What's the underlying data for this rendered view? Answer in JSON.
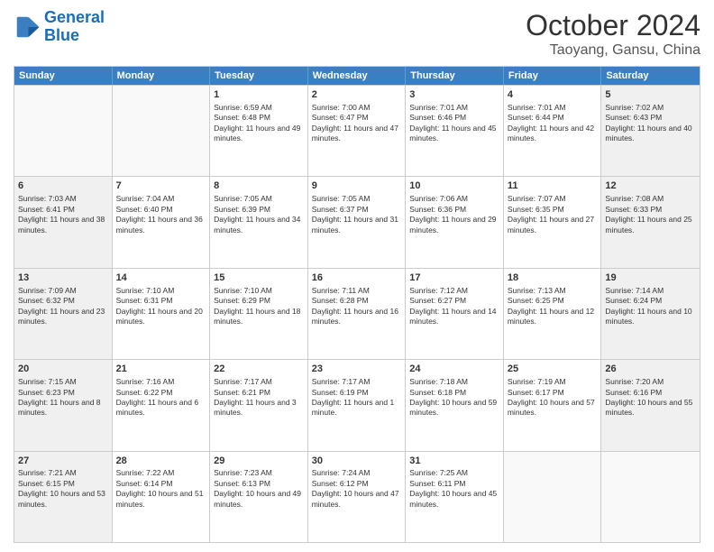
{
  "logo": {
    "line1": "General",
    "line2": "Blue"
  },
  "header": {
    "title": "October 2024",
    "subtitle": "Taoyang, Gansu, China"
  },
  "weekdays": [
    "Sunday",
    "Monday",
    "Tuesday",
    "Wednesday",
    "Thursday",
    "Friday",
    "Saturday"
  ],
  "weeks": [
    [
      {
        "day": "",
        "empty": true
      },
      {
        "day": "",
        "empty": true
      },
      {
        "day": "1",
        "sunrise": "Sunrise: 6:59 AM",
        "sunset": "Sunset: 6:48 PM",
        "daylight": "Daylight: 11 hours and 49 minutes."
      },
      {
        "day": "2",
        "sunrise": "Sunrise: 7:00 AM",
        "sunset": "Sunset: 6:47 PM",
        "daylight": "Daylight: 11 hours and 47 minutes."
      },
      {
        "day": "3",
        "sunrise": "Sunrise: 7:01 AM",
        "sunset": "Sunset: 6:46 PM",
        "daylight": "Daylight: 11 hours and 45 minutes."
      },
      {
        "day": "4",
        "sunrise": "Sunrise: 7:01 AM",
        "sunset": "Sunset: 6:44 PM",
        "daylight": "Daylight: 11 hours and 42 minutes."
      },
      {
        "day": "5",
        "sunrise": "Sunrise: 7:02 AM",
        "sunset": "Sunset: 6:43 PM",
        "daylight": "Daylight: 11 hours and 40 minutes."
      }
    ],
    [
      {
        "day": "6",
        "sunrise": "Sunrise: 7:03 AM",
        "sunset": "Sunset: 6:41 PM",
        "daylight": "Daylight: 11 hours and 38 minutes."
      },
      {
        "day": "7",
        "sunrise": "Sunrise: 7:04 AM",
        "sunset": "Sunset: 6:40 PM",
        "daylight": "Daylight: 11 hours and 36 minutes."
      },
      {
        "day": "8",
        "sunrise": "Sunrise: 7:05 AM",
        "sunset": "Sunset: 6:39 PM",
        "daylight": "Daylight: 11 hours and 34 minutes."
      },
      {
        "day": "9",
        "sunrise": "Sunrise: 7:05 AM",
        "sunset": "Sunset: 6:37 PM",
        "daylight": "Daylight: 11 hours and 31 minutes."
      },
      {
        "day": "10",
        "sunrise": "Sunrise: 7:06 AM",
        "sunset": "Sunset: 6:36 PM",
        "daylight": "Daylight: 11 hours and 29 minutes."
      },
      {
        "day": "11",
        "sunrise": "Sunrise: 7:07 AM",
        "sunset": "Sunset: 6:35 PM",
        "daylight": "Daylight: 11 hours and 27 minutes."
      },
      {
        "day": "12",
        "sunrise": "Sunrise: 7:08 AM",
        "sunset": "Sunset: 6:33 PM",
        "daylight": "Daylight: 11 hours and 25 minutes."
      }
    ],
    [
      {
        "day": "13",
        "sunrise": "Sunrise: 7:09 AM",
        "sunset": "Sunset: 6:32 PM",
        "daylight": "Daylight: 11 hours and 23 minutes."
      },
      {
        "day": "14",
        "sunrise": "Sunrise: 7:10 AM",
        "sunset": "Sunset: 6:31 PM",
        "daylight": "Daylight: 11 hours and 20 minutes."
      },
      {
        "day": "15",
        "sunrise": "Sunrise: 7:10 AM",
        "sunset": "Sunset: 6:29 PM",
        "daylight": "Daylight: 11 hours and 18 minutes."
      },
      {
        "day": "16",
        "sunrise": "Sunrise: 7:11 AM",
        "sunset": "Sunset: 6:28 PM",
        "daylight": "Daylight: 11 hours and 16 minutes."
      },
      {
        "day": "17",
        "sunrise": "Sunrise: 7:12 AM",
        "sunset": "Sunset: 6:27 PM",
        "daylight": "Daylight: 11 hours and 14 minutes."
      },
      {
        "day": "18",
        "sunrise": "Sunrise: 7:13 AM",
        "sunset": "Sunset: 6:25 PM",
        "daylight": "Daylight: 11 hours and 12 minutes."
      },
      {
        "day": "19",
        "sunrise": "Sunrise: 7:14 AM",
        "sunset": "Sunset: 6:24 PM",
        "daylight": "Daylight: 11 hours and 10 minutes."
      }
    ],
    [
      {
        "day": "20",
        "sunrise": "Sunrise: 7:15 AM",
        "sunset": "Sunset: 6:23 PM",
        "daylight": "Daylight: 11 hours and 8 minutes."
      },
      {
        "day": "21",
        "sunrise": "Sunrise: 7:16 AM",
        "sunset": "Sunset: 6:22 PM",
        "daylight": "Daylight: 11 hours and 6 minutes."
      },
      {
        "day": "22",
        "sunrise": "Sunrise: 7:17 AM",
        "sunset": "Sunset: 6:21 PM",
        "daylight": "Daylight: 11 hours and 3 minutes."
      },
      {
        "day": "23",
        "sunrise": "Sunrise: 7:17 AM",
        "sunset": "Sunset: 6:19 PM",
        "daylight": "Daylight: 11 hours and 1 minute."
      },
      {
        "day": "24",
        "sunrise": "Sunrise: 7:18 AM",
        "sunset": "Sunset: 6:18 PM",
        "daylight": "Daylight: 10 hours and 59 minutes."
      },
      {
        "day": "25",
        "sunrise": "Sunrise: 7:19 AM",
        "sunset": "Sunset: 6:17 PM",
        "daylight": "Daylight: 10 hours and 57 minutes."
      },
      {
        "day": "26",
        "sunrise": "Sunrise: 7:20 AM",
        "sunset": "Sunset: 6:16 PM",
        "daylight": "Daylight: 10 hours and 55 minutes."
      }
    ],
    [
      {
        "day": "27",
        "sunrise": "Sunrise: 7:21 AM",
        "sunset": "Sunset: 6:15 PM",
        "daylight": "Daylight: 10 hours and 53 minutes."
      },
      {
        "day": "28",
        "sunrise": "Sunrise: 7:22 AM",
        "sunset": "Sunset: 6:14 PM",
        "daylight": "Daylight: 10 hours and 51 minutes."
      },
      {
        "day": "29",
        "sunrise": "Sunrise: 7:23 AM",
        "sunset": "Sunset: 6:13 PM",
        "daylight": "Daylight: 10 hours and 49 minutes."
      },
      {
        "day": "30",
        "sunrise": "Sunrise: 7:24 AM",
        "sunset": "Sunset: 6:12 PM",
        "daylight": "Daylight: 10 hours and 47 minutes."
      },
      {
        "day": "31",
        "sunrise": "Sunrise: 7:25 AM",
        "sunset": "Sunset: 6:11 PM",
        "daylight": "Daylight: 10 hours and 45 minutes."
      },
      {
        "day": "",
        "empty": true
      },
      {
        "day": "",
        "empty": true
      }
    ]
  ]
}
